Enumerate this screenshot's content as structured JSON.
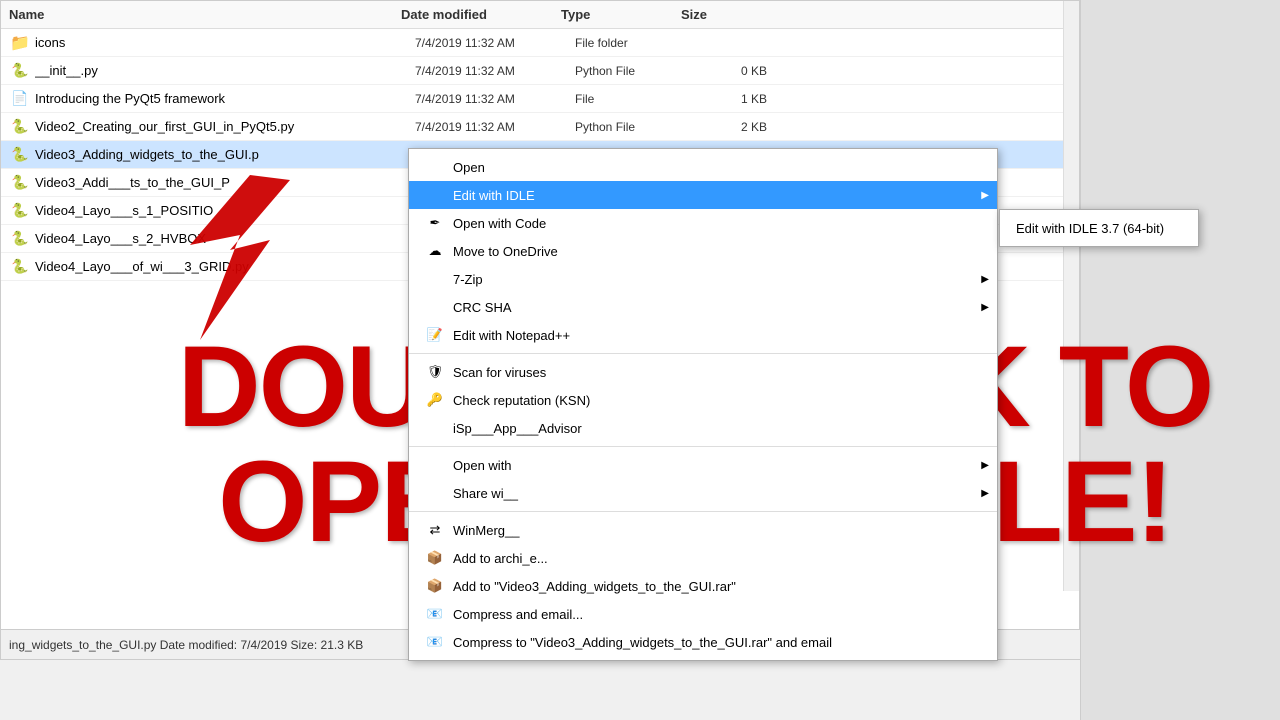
{
  "header": {
    "name_col": "Name",
    "date_col": "Date modified",
    "type_col": "Type",
    "size_col": "Size"
  },
  "files": [
    {
      "name": "icons",
      "date": "7/4/2019 11:32 AM",
      "type": "File folder",
      "size": "",
      "kind": "folder"
    },
    {
      "name": "__init__.py",
      "date": "7/4/2019 11:32 AM",
      "type": "Python File",
      "size": "0 KB",
      "kind": "py"
    },
    {
      "name": "Introducing the PyQt5 framework",
      "date": "7/4/2019 11:32 AM",
      "type": "File",
      "size": "1 KB",
      "kind": "file"
    },
    {
      "name": "Video2_Creating_our_first_GUI_in_PyQt5.py",
      "date": "7/4/2019 11:32 AM",
      "type": "Python File",
      "size": "2 KB",
      "kind": "py"
    },
    {
      "name": "Video3_Adding_widgets_to_the_GUI.p",
      "date": "",
      "type": "",
      "size": "",
      "kind": "py",
      "selected": true
    },
    {
      "name": "Video3_Addi___ts_to_the_GUI_P",
      "date": "",
      "type": "",
      "size": "",
      "kind": "py"
    },
    {
      "name": "Video4_Layo___s_1_POSITIO",
      "date": "",
      "type": "",
      "size": "",
      "kind": "py"
    },
    {
      "name": "Video4_Layo___s_2_HVBOX",
      "date": "",
      "type": "",
      "size": "",
      "kind": "py"
    },
    {
      "name": "Video4_Layo___of_wi___3_GRID.py",
      "date": "",
      "type": "",
      "size": "",
      "kind": "py"
    }
  ],
  "context_menu": {
    "items": [
      {
        "label": "Open",
        "icon": "",
        "has_submenu": false,
        "id": "open"
      },
      {
        "label": "Edit with IDLE",
        "icon": "",
        "has_submenu": true,
        "id": "edit-idle",
        "highlighted": true
      },
      {
        "label": "Open with Code",
        "icon": "vscode",
        "has_submenu": false,
        "id": "open-code"
      },
      {
        "label": "Move to OneDrive",
        "icon": "onedrive",
        "has_submenu": false,
        "id": "move-onedrive"
      },
      {
        "label": "7-Zip",
        "icon": "",
        "has_submenu": true,
        "id": "7zip"
      },
      {
        "label": "CRC SHA",
        "icon": "",
        "has_submenu": true,
        "id": "crc-sha"
      },
      {
        "label": "Edit with Notepad++",
        "icon": "notepad",
        "has_submenu": false,
        "id": "notepadpp"
      },
      {
        "label": "Scan for viruses",
        "icon": "scan",
        "has_submenu": false,
        "id": "scan"
      },
      {
        "label": "Check reputation (KSN)",
        "icon": "kaspersky",
        "has_submenu": false,
        "id": "reputation"
      },
      {
        "label": "iSp___App___Advisor",
        "icon": "",
        "has_submenu": false,
        "id": "advisor"
      },
      {
        "label": "Open with",
        "icon": "",
        "has_submenu": true,
        "id": "open-with"
      },
      {
        "label": "Share wi__",
        "icon": "",
        "has_submenu": true,
        "id": "share"
      },
      {
        "label": "WinMerg__",
        "icon": "winmerge",
        "has_submenu": false,
        "id": "winmerge"
      },
      {
        "label": "Add to archi_e...",
        "icon": "archive",
        "has_submenu": false,
        "id": "add-archive"
      },
      {
        "label": "Add to \"Video3_Adding_widgets_to_the_GUI.rar\"",
        "icon": "rar",
        "has_submenu": false,
        "id": "add-rar"
      },
      {
        "label": "Compress and email...",
        "icon": "compress",
        "has_submenu": false,
        "id": "compress-email"
      },
      {
        "label": "Compress to \"Video3_Adding_widgets_to_the_GUI.rar\" and email",
        "icon": "compress-rar",
        "has_submenu": false,
        "id": "compress-rar-email"
      }
    ],
    "submenu": {
      "items": [
        {
          "label": "Edit with IDLE 3.7 (64-bit)"
        }
      ]
    }
  },
  "overlay": {
    "line1": "DOUBLE-CLICK TO",
    "line2": "OPEN WITH IDLE!"
  },
  "status_bar": {
    "filename": "ing_widgets_to_the_GUI.py",
    "date_label": "Date modified:",
    "date_value": "7/4/2019",
    "size_label": "Size:",
    "size_value": "21.3 KB"
  }
}
